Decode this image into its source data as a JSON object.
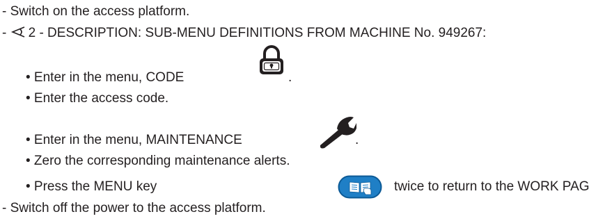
{
  "instructions": {
    "line1": "- Switch on the access platform.",
    "line2_prefix": "- ",
    "line2_text": "2 - DESCRIPTION: SUB-MENU DEFINITIONS FROM MACHINE No. 949267:",
    "bullets": [
      {
        "text": "• Enter in the menu, CODE",
        "trail": "."
      },
      {
        "text": "• Enter the access code."
      },
      {
        "text": "• Enter in the menu, MAINTENANCE",
        "trail": "."
      },
      {
        "text": "• Zero the corresponding maintenance alerts."
      },
      {
        "text": "• Press the MENU key",
        "trail": "twice to return to the WORK PAGE."
      }
    ],
    "last": "- Switch off the power to the access platform."
  },
  "icons": {
    "reference": "reference-pointer-icon",
    "lock": "padlock-icon",
    "wrench": "wrench-icon",
    "menu": "menu-book-key-icon"
  },
  "colors": {
    "text": "#231f20",
    "menu_key_fill": "#1f7fc6",
    "menu_key_border": "#0c5a96"
  }
}
